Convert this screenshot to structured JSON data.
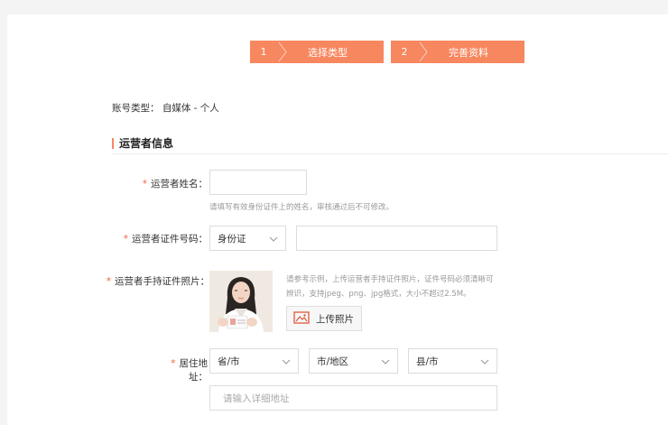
{
  "steps": [
    {
      "num": "1",
      "label": "选择类型"
    },
    {
      "num": "2",
      "label": "完善资料"
    }
  ],
  "account_type": "账号类型： 自媒体 - 个人",
  "section_title": "运营者信息",
  "fields": {
    "name": {
      "label": "运营者姓名：",
      "value": "",
      "hint": "请填写有效身份证件上的姓名，审核通过后不可修改。"
    },
    "id_number": {
      "label": "运营者证件号码：",
      "id_type_selected": "身份证",
      "value": ""
    },
    "id_photo": {
      "label": "运营者手持证件照片：",
      "hint_line1": "请参考示例，上传运营者手持证件照片，证件号码必须清晰可",
      "hint_line2": "辨识，支持jpeg、png、jpg格式，大小不超过2.5M。",
      "upload_label": "上传照片"
    },
    "address": {
      "label": "居住地址：",
      "province": "省/市",
      "city": "市/地区",
      "county": "县/市",
      "detail_placeholder": "请输入详细地址"
    }
  },
  "required_mark": "*",
  "colors": {
    "accent": "#f7875f",
    "required": "#f5623d",
    "hint": "#999999"
  },
  "icons": {
    "chevron": "chevron-down-icon",
    "upload": "image-icon",
    "step_arrow": "chevron-right-icon"
  }
}
